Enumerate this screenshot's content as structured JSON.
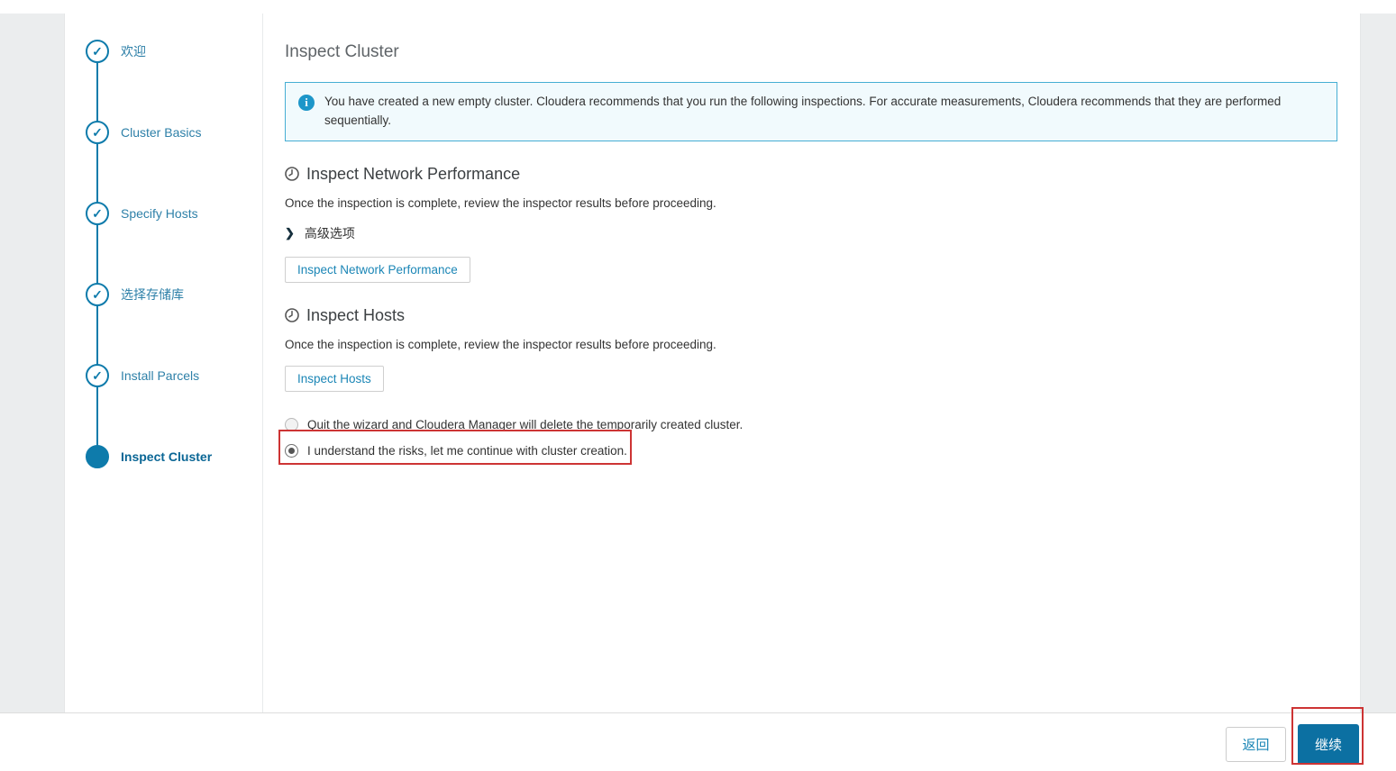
{
  "colors": {
    "accent_blue": "#0e7bab",
    "link_blue": "#1b86b6",
    "active_step_blue": "#0a6695",
    "banner_border": "#46aed3",
    "banner_bg": "#f1fafd",
    "info_icon_bg": "#1d96c9",
    "continue_button_bg": "#0c70a2",
    "annotation_red": "#cd3434",
    "page_bg": "#ebedee"
  },
  "icons": {
    "check": "✓",
    "chevron_right": "❯",
    "info": "i"
  },
  "sidebar": {
    "steps": [
      {
        "label": "欢迎",
        "state": "completed"
      },
      {
        "label": "Cluster Basics",
        "state": "completed"
      },
      {
        "label": "Specify Hosts",
        "state": "completed"
      },
      {
        "label": "选择存储库",
        "state": "completed"
      },
      {
        "label": "Install Parcels",
        "state": "completed"
      },
      {
        "label": "Inspect Cluster",
        "state": "current"
      }
    ]
  },
  "main": {
    "title": "Inspect Cluster",
    "banner": {
      "text": "You have created a new empty cluster. Cloudera recommends that you run the following inspections. For accurate measurements, Cloudera recommends that they are performed sequentially."
    },
    "sections": [
      {
        "heading": "Inspect Network Performance",
        "description": "Once the inspection is complete, review the inspector results before proceeding.",
        "advanced_label": "高级选项",
        "button_label": "Inspect Network Performance"
      },
      {
        "heading": "Inspect Hosts",
        "description": "Once the inspection is complete, review the inspector results before proceeding.",
        "button_label": "Inspect Hosts"
      }
    ],
    "radios": [
      {
        "label": "Quit the wizard and Cloudera Manager will delete the temporarily created cluster.",
        "selected": false
      },
      {
        "label": "I understand the risks, let me continue with cluster creation.",
        "selected": true
      }
    ]
  },
  "footer": {
    "back_label": "返回",
    "continue_label": "继续"
  }
}
